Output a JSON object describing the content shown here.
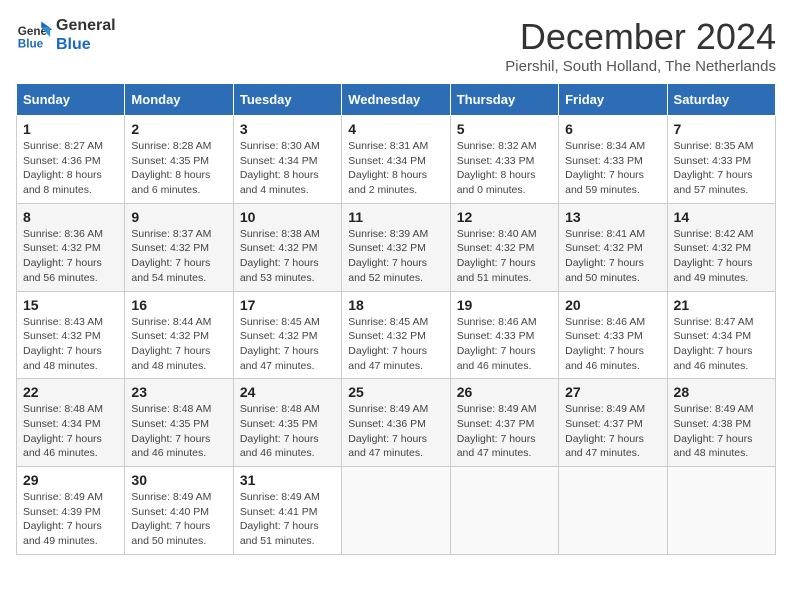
{
  "header": {
    "logo_line1": "General",
    "logo_line2": "Blue",
    "month": "December 2024",
    "location": "Piershil, South Holland, The Netherlands"
  },
  "weekdays": [
    "Sunday",
    "Monday",
    "Tuesday",
    "Wednesday",
    "Thursday",
    "Friday",
    "Saturday"
  ],
  "weeks": [
    [
      {
        "day": "1",
        "sunrise": "Sunrise: 8:27 AM",
        "sunset": "Sunset: 4:36 PM",
        "daylight": "Daylight: 8 hours and 8 minutes."
      },
      {
        "day": "2",
        "sunrise": "Sunrise: 8:28 AM",
        "sunset": "Sunset: 4:35 PM",
        "daylight": "Daylight: 8 hours and 6 minutes."
      },
      {
        "day": "3",
        "sunrise": "Sunrise: 8:30 AM",
        "sunset": "Sunset: 4:34 PM",
        "daylight": "Daylight: 8 hours and 4 minutes."
      },
      {
        "day": "4",
        "sunrise": "Sunrise: 8:31 AM",
        "sunset": "Sunset: 4:34 PM",
        "daylight": "Daylight: 8 hours and 2 minutes."
      },
      {
        "day": "5",
        "sunrise": "Sunrise: 8:32 AM",
        "sunset": "Sunset: 4:33 PM",
        "daylight": "Daylight: 8 hours and 0 minutes."
      },
      {
        "day": "6",
        "sunrise": "Sunrise: 8:34 AM",
        "sunset": "Sunset: 4:33 PM",
        "daylight": "Daylight: 7 hours and 59 minutes."
      },
      {
        "day": "7",
        "sunrise": "Sunrise: 8:35 AM",
        "sunset": "Sunset: 4:33 PM",
        "daylight": "Daylight: 7 hours and 57 minutes."
      }
    ],
    [
      {
        "day": "8",
        "sunrise": "Sunrise: 8:36 AM",
        "sunset": "Sunset: 4:32 PM",
        "daylight": "Daylight: 7 hours and 56 minutes."
      },
      {
        "day": "9",
        "sunrise": "Sunrise: 8:37 AM",
        "sunset": "Sunset: 4:32 PM",
        "daylight": "Daylight: 7 hours and 54 minutes."
      },
      {
        "day": "10",
        "sunrise": "Sunrise: 8:38 AM",
        "sunset": "Sunset: 4:32 PM",
        "daylight": "Daylight: 7 hours and 53 minutes."
      },
      {
        "day": "11",
        "sunrise": "Sunrise: 8:39 AM",
        "sunset": "Sunset: 4:32 PM",
        "daylight": "Daylight: 7 hours and 52 minutes."
      },
      {
        "day": "12",
        "sunrise": "Sunrise: 8:40 AM",
        "sunset": "Sunset: 4:32 PM",
        "daylight": "Daylight: 7 hours and 51 minutes."
      },
      {
        "day": "13",
        "sunrise": "Sunrise: 8:41 AM",
        "sunset": "Sunset: 4:32 PM",
        "daylight": "Daylight: 7 hours and 50 minutes."
      },
      {
        "day": "14",
        "sunrise": "Sunrise: 8:42 AM",
        "sunset": "Sunset: 4:32 PM",
        "daylight": "Daylight: 7 hours and 49 minutes."
      }
    ],
    [
      {
        "day": "15",
        "sunrise": "Sunrise: 8:43 AM",
        "sunset": "Sunset: 4:32 PM",
        "daylight": "Daylight: 7 hours and 48 minutes."
      },
      {
        "day": "16",
        "sunrise": "Sunrise: 8:44 AM",
        "sunset": "Sunset: 4:32 PM",
        "daylight": "Daylight: 7 hours and 48 minutes."
      },
      {
        "day": "17",
        "sunrise": "Sunrise: 8:45 AM",
        "sunset": "Sunset: 4:32 PM",
        "daylight": "Daylight: 7 hours and 47 minutes."
      },
      {
        "day": "18",
        "sunrise": "Sunrise: 8:45 AM",
        "sunset": "Sunset: 4:32 PM",
        "daylight": "Daylight: 7 hours and 47 minutes."
      },
      {
        "day": "19",
        "sunrise": "Sunrise: 8:46 AM",
        "sunset": "Sunset: 4:33 PM",
        "daylight": "Daylight: 7 hours and 46 minutes."
      },
      {
        "day": "20",
        "sunrise": "Sunrise: 8:46 AM",
        "sunset": "Sunset: 4:33 PM",
        "daylight": "Daylight: 7 hours and 46 minutes."
      },
      {
        "day": "21",
        "sunrise": "Sunrise: 8:47 AM",
        "sunset": "Sunset: 4:34 PM",
        "daylight": "Daylight: 7 hours and 46 minutes."
      }
    ],
    [
      {
        "day": "22",
        "sunrise": "Sunrise: 8:48 AM",
        "sunset": "Sunset: 4:34 PM",
        "daylight": "Daylight: 7 hours and 46 minutes."
      },
      {
        "day": "23",
        "sunrise": "Sunrise: 8:48 AM",
        "sunset": "Sunset: 4:35 PM",
        "daylight": "Daylight: 7 hours and 46 minutes."
      },
      {
        "day": "24",
        "sunrise": "Sunrise: 8:48 AM",
        "sunset": "Sunset: 4:35 PM",
        "daylight": "Daylight: 7 hours and 46 minutes."
      },
      {
        "day": "25",
        "sunrise": "Sunrise: 8:49 AM",
        "sunset": "Sunset: 4:36 PM",
        "daylight": "Daylight: 7 hours and 47 minutes."
      },
      {
        "day": "26",
        "sunrise": "Sunrise: 8:49 AM",
        "sunset": "Sunset: 4:37 PM",
        "daylight": "Daylight: 7 hours and 47 minutes."
      },
      {
        "day": "27",
        "sunrise": "Sunrise: 8:49 AM",
        "sunset": "Sunset: 4:37 PM",
        "daylight": "Daylight: 7 hours and 47 minutes."
      },
      {
        "day": "28",
        "sunrise": "Sunrise: 8:49 AM",
        "sunset": "Sunset: 4:38 PM",
        "daylight": "Daylight: 7 hours and 48 minutes."
      }
    ],
    [
      {
        "day": "29",
        "sunrise": "Sunrise: 8:49 AM",
        "sunset": "Sunset: 4:39 PM",
        "daylight": "Daylight: 7 hours and 49 minutes."
      },
      {
        "day": "30",
        "sunrise": "Sunrise: 8:49 AM",
        "sunset": "Sunset: 4:40 PM",
        "daylight": "Daylight: 7 hours and 50 minutes."
      },
      {
        "day": "31",
        "sunrise": "Sunrise: 8:49 AM",
        "sunset": "Sunset: 4:41 PM",
        "daylight": "Daylight: 7 hours and 51 minutes."
      },
      null,
      null,
      null,
      null
    ]
  ]
}
